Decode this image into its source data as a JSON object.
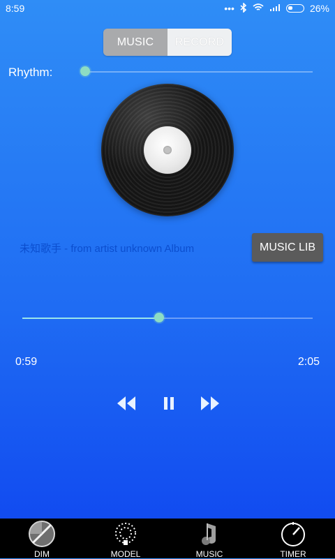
{
  "status_bar": {
    "time": "8:59",
    "battery_percent": "26%",
    "icons": [
      "dots-icon",
      "bluetooth-icon",
      "wifi-icon",
      "signal-icon",
      "battery-icon"
    ]
  },
  "mode_toggle": {
    "left_label": "MUSIC",
    "right_label": "RECORD",
    "selected": "MUSIC"
  },
  "rhythm": {
    "label": "Rhythm:",
    "value_fraction": 0.0
  },
  "player": {
    "song_text": "未知歌手 - from artist unknown Album",
    "music_lib_label": "MUSIC LIB",
    "elapsed": "0:59",
    "duration": "2:05",
    "progress_fraction": 0.47
  },
  "controls": {
    "prev_icon": "rewind-icon",
    "pause_icon": "pause-icon",
    "next_icon": "fast-forward-icon"
  },
  "bottom_nav": {
    "items": [
      {
        "label": "DIM",
        "icon": "dim-icon"
      },
      {
        "label": "MODEL",
        "icon": "model-icon"
      },
      {
        "label": "MUSIC",
        "icon": "music-note-icon"
      },
      {
        "label": "TIMER",
        "icon": "timer-icon"
      }
    ]
  },
  "colors": {
    "background_top": "#2f8df6",
    "background_bottom": "#0f45f0",
    "thumb": "#8ddcc3",
    "song_text": "#0b4ecf",
    "button_dark": "#5b5b5b"
  }
}
